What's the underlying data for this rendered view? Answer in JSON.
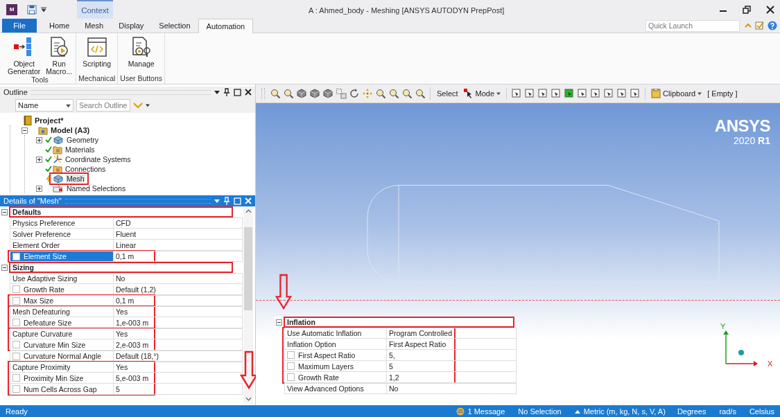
{
  "window": {
    "app_letter": "M",
    "context_tab": "Context",
    "title": "A : Ahmed_body - Meshing [ANSYS AUTODYN PrepPost]"
  },
  "quick_launch": {
    "placeholder": "Quick Launch"
  },
  "tabs": [
    {
      "label": "File",
      "kind": "file",
      "selected": false
    },
    {
      "label": "Home",
      "kind": "tab",
      "selected": false
    },
    {
      "label": "Mesh",
      "kind": "tab",
      "selected": false
    },
    {
      "label": "Display",
      "kind": "tab",
      "selected": false
    },
    {
      "label": "Selection",
      "kind": "tab",
      "selected": false
    },
    {
      "label": "Automation",
      "kind": "tab",
      "selected": true
    }
  ],
  "ribbon_groups": [
    {
      "label": "Tools",
      "buttons": [
        {
          "label": "Object Generator",
          "kind": "generator"
        },
        {
          "label": "Run Macro...",
          "kind": "macro"
        }
      ]
    },
    {
      "label": "Mechanical",
      "buttons": [
        {
          "label": "Scripting",
          "kind": "script"
        }
      ]
    },
    {
      "label": "User Buttons",
      "buttons": [
        {
          "label": "Manage",
          "kind": "manage"
        }
      ]
    }
  ],
  "toolbar": {
    "select_label": "Select",
    "mode_menu": "Mode",
    "clipboard_menu": "Clipboard",
    "clipboard_state": "[ Empty ]"
  },
  "outline": {
    "title": "Outline",
    "column_select": "Name",
    "search": {
      "placeholder": "Search Outline"
    },
    "tree": [
      {
        "label": "Project*",
        "kind": "project",
        "selected": false,
        "marked": false,
        "children": [
          {
            "label": "Model (A3)",
            "kind": "model",
            "expanded": true,
            "selected": false,
            "marked": false,
            "children": [
              {
                "label": "Geometry",
                "kind": "geometry",
                "expanded": false,
                "done": true,
                "selected": false,
                "marked": false
              },
              {
                "label": "Materials",
                "kind": "folder",
                "done": true,
                "selected": false,
                "marked": false
              },
              {
                "label": "Coordinate Systems",
                "kind": "axes",
                "expanded": false,
                "done": true,
                "selected": false,
                "marked": false
              },
              {
                "label": "Connections",
                "kind": "folder",
                "done": true,
                "selected": false,
                "marked": false
              },
              {
                "label": "Mesh",
                "kind": "geometry",
                "done": false,
                "selected": true,
                "marked": true
              },
              {
                "label": "Named Selections",
                "kind": "selection",
                "expanded": false,
                "selected": false,
                "marked": false
              }
            ]
          }
        ]
      }
    ]
  },
  "details": {
    "title": "Details of \"Mesh\"",
    "groups": [
      {
        "label": "Defaults",
        "expanded": true,
        "marked": true,
        "blocks": [
          {
            "marked": false,
            "rows": [
              {
                "name": "Physics Preference",
                "value": "CFD",
                "kind": "plain",
                "selected": false
              },
              {
                "name": "Solver Preference",
                "value": "Fluent",
                "kind": "plain",
                "selected": false
              },
              {
                "name": "Element Order",
                "value": "Linear",
                "kind": "plain",
                "selected": false
              }
            ]
          },
          {
            "marked": true,
            "rows": [
              {
                "name": "Element Size",
                "value": "0,1 m",
                "kind": "parameter",
                "selected": true
              }
            ]
          }
        ]
      },
      {
        "label": "Sizing",
        "expanded": true,
        "marked": true,
        "blocks": [
          {
            "marked": false,
            "rows": [
              {
                "name": "Use Adaptive Sizing",
                "value": "No",
                "kind": "plain",
                "selected": false
              },
              {
                "name": "Growth Rate",
                "value": "Default (1,2)",
                "kind": "parameter",
                "selected": false
              }
            ]
          },
          {
            "marked": true,
            "rows": [
              {
                "name": "Max Size",
                "value": "0,1 m",
                "kind": "parameter",
                "selected": false
              }
            ]
          },
          {
            "marked": true,
            "rows": [
              {
                "name": "Mesh Defeaturing",
                "value": "Yes",
                "kind": "plain",
                "selected": false
              },
              {
                "name": "Defeature Size",
                "value": "1,e-003 m",
                "kind": "parameter",
                "selected": false
              }
            ]
          },
          {
            "marked": true,
            "rows": [
              {
                "name": "Capture Curvature",
                "value": "Yes",
                "kind": "plain",
                "selected": false
              },
              {
                "name": "Curvature Min Size",
                "value": "2,e-003 m",
                "kind": "parameter",
                "selected": false
              }
            ]
          },
          {
            "marked": false,
            "rows": [
              {
                "name": "Curvature Normal Angle",
                "value": "Default (18,°)",
                "kind": "parameter",
                "selected": false
              }
            ]
          },
          {
            "marked": true,
            "rows": [
              {
                "name": "Capture Proximity",
                "value": "Yes",
                "kind": "plain",
                "selected": false
              },
              {
                "name": "Proximity Min Size",
                "value": "5,e-003 m",
                "kind": "parameter",
                "selected": false
              },
              {
                "name": "Num Cells Across Gap",
                "value": "5",
                "kind": "parameter",
                "selected": false
              }
            ]
          }
        ]
      }
    ]
  },
  "viewport": {
    "logo": "ANSYS",
    "version": "2020 **R1**",
    "axis_y": "Y",
    "axis_x": "X"
  },
  "inflation": {
    "label": "Inflation",
    "expanded": true,
    "marked": true,
    "blocks": [
      {
        "marked": true,
        "rows": [
          {
            "name": "Use Automatic Inflation",
            "value": "Program Controlled",
            "kind": "plain",
            "selected": false
          },
          {
            "name": "Inflation Option",
            "value": "First Aspect Ratio",
            "kind": "plain",
            "selected": false
          },
          {
            "name": "First Aspect Ratio",
            "value": "5,",
            "kind": "parameter",
            "selected": false
          },
          {
            "name": "Maximum Layers",
            "value": "5",
            "kind": "parameter",
            "selected": false
          },
          {
            "name": "Growth Rate",
            "value": "1,2",
            "kind": "parameter",
            "selected": false
          }
        ]
      },
      {
        "marked": false,
        "rows": [
          {
            "name": "View Advanced Options",
            "value": "No",
            "kind": "plain",
            "selected": false
          }
        ]
      }
    ]
  },
  "status_bar": {
    "ready": "Ready",
    "messages": "1 Message",
    "selection": "No Selection",
    "units": "Metric (m, kg, N, s, V, A)",
    "angle": "Degrees",
    "rotation": "rad/s",
    "temperature": "Celsius"
  }
}
